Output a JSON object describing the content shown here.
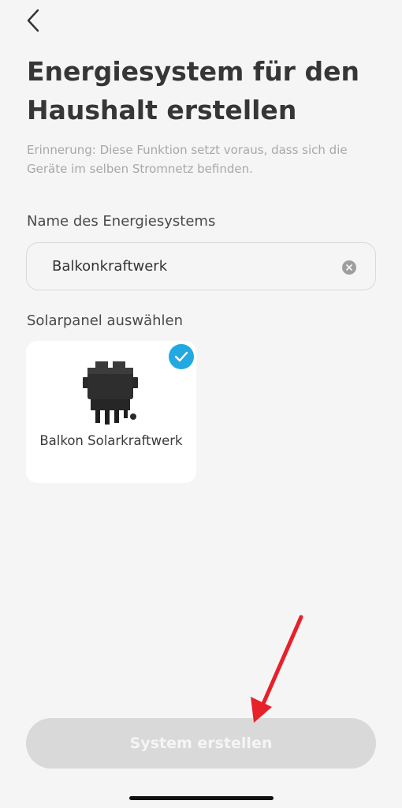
{
  "header": {
    "back_icon": "chevron-left-icon"
  },
  "page": {
    "title": "Energiesystem für den Haushalt erstellen",
    "hint": "Erinnerung: Diese Funktion setzt voraus, dass sich die Geräte im selben Stromnetz befinden."
  },
  "name_field": {
    "label": "Name des Energiesystems",
    "value": "Balkonkraftwerk",
    "clear_icon": "clear-icon"
  },
  "solar_panel": {
    "label": "Solarpanel auswählen",
    "items": [
      {
        "name": "Balkon Solarkraftwerk",
        "selected": true,
        "icon": "microinverter-device-icon"
      }
    ]
  },
  "actions": {
    "create_label": "System erstellen"
  },
  "colors": {
    "background": "#f5f5f5",
    "accent": "#22a9e1",
    "button_disabled": "#d9d9d9",
    "annotation_arrow": "#e8202a"
  }
}
